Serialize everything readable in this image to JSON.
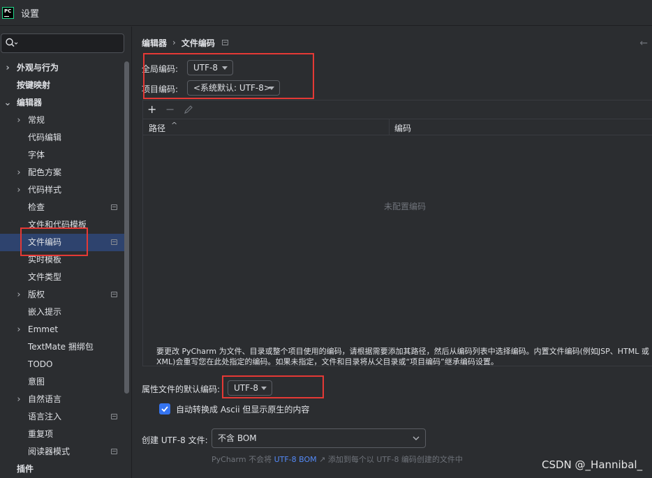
{
  "app": {
    "window_title": "设置",
    "logo_text": "PC"
  },
  "search": {
    "placeholder": ""
  },
  "sidebar": {
    "items": [
      {
        "label": "外观与行为"
      },
      {
        "label": "按键映射"
      },
      {
        "label": "编辑器"
      },
      {
        "label": "常规"
      },
      {
        "label": "代码编辑"
      },
      {
        "label": "字体"
      },
      {
        "label": "配色方案"
      },
      {
        "label": "代码样式"
      },
      {
        "label": "检查"
      },
      {
        "label": "文件和代码模板"
      },
      {
        "label": "文件编码"
      },
      {
        "label": "实时模板"
      },
      {
        "label": "文件类型"
      },
      {
        "label": "版权"
      },
      {
        "label": "嵌入提示"
      },
      {
        "label": "Emmet"
      },
      {
        "label": "TextMate 捆绑包"
      },
      {
        "label": "TODO"
      },
      {
        "label": "意图"
      },
      {
        "label": "自然语言"
      },
      {
        "label": "语言注入"
      },
      {
        "label": "重复项"
      },
      {
        "label": "阅读器模式"
      },
      {
        "label": "插件"
      }
    ]
  },
  "breadcrumb": {
    "parent": "编辑器",
    "separator": "›",
    "current": "文件编码"
  },
  "global_encoding": {
    "label": "全局编码:",
    "value": "UTF-8"
  },
  "project_encoding": {
    "label": "项目编码:",
    "value": "<系统默认: UTF-8>"
  },
  "table": {
    "col_path": "路径",
    "col_encoding": "编码",
    "empty_text": "未配置编码"
  },
  "hint_text": "要更改 PyCharm 为文件、目录或整个项目使用的编码，请根据需要添加其路径，然后从编码列表中选择编码。内置文件编码(例如JSP、HTML 或 XML)会重写您在此处指定的编码。如果未指定，文件和目录将从父目录或“项目编码”继承编码设置。",
  "properties_encoding": {
    "label": "属性文件的默认编码:",
    "value": "UTF-8"
  },
  "native_to_ascii": {
    "label": "自动转换成 Ascii 但显示原生的内容",
    "checked": true
  },
  "bom": {
    "label": "创建 UTF-8 文件:",
    "value": "不含 BOM"
  },
  "footer_note": {
    "prefix": "PyCharm 不会将",
    "link": "UTF-8 BOM",
    "link_arrow": "↗",
    "suffix": "添加到每个以 UTF-8 编码创建的文件中"
  },
  "watermark": "CSDN @_Hannibal_",
  "colors": {
    "background": "#2b2d30",
    "selection": "#2e436e",
    "accent": "#3574f0",
    "link": "#548af7",
    "annotation_red": "#e53935"
  }
}
